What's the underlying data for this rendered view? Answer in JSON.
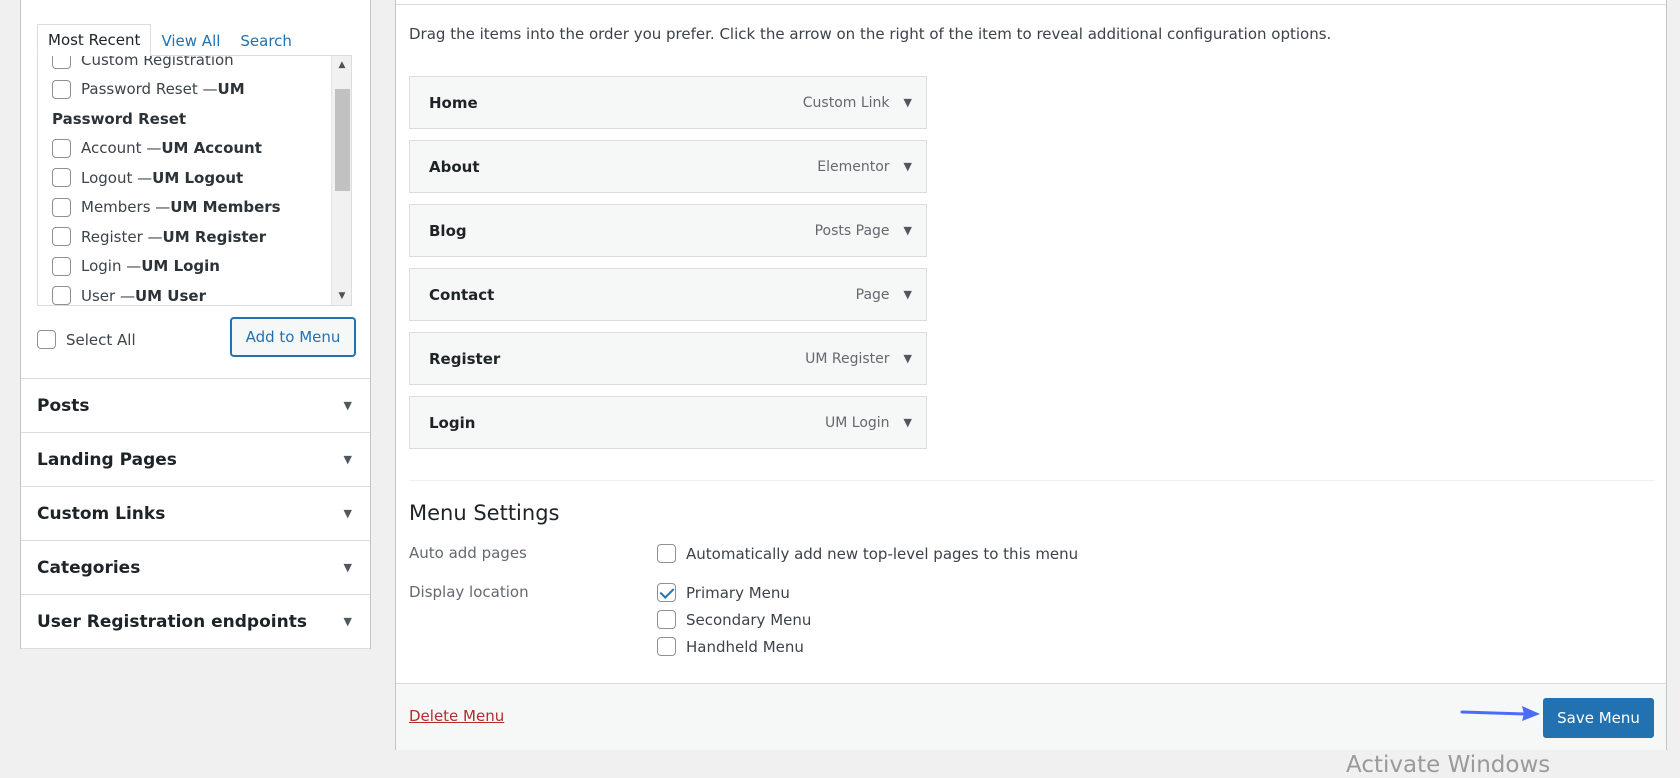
{
  "left_panel": {
    "tabs": [
      {
        "label": "Most Recent",
        "active": true
      },
      {
        "label": "View All",
        "active": false
      },
      {
        "label": "Search",
        "active": false
      }
    ],
    "items": [
      {
        "type": "checkbox",
        "label": "Custom Registration",
        "suffix": ""
      },
      {
        "type": "checkbox",
        "label": "Password Reset — ",
        "suffix": "UM"
      },
      {
        "type": "heading",
        "label": "Password Reset",
        "suffix": ""
      },
      {
        "type": "checkbox",
        "label": "Account — ",
        "suffix": "UM Account"
      },
      {
        "type": "checkbox",
        "label": "Logout — ",
        "suffix": "UM Logout"
      },
      {
        "type": "checkbox",
        "label": "Members — ",
        "suffix": "UM Members"
      },
      {
        "type": "checkbox",
        "label": "Register — ",
        "suffix": "UM Register"
      },
      {
        "type": "checkbox",
        "label": "Login — ",
        "suffix": "UM Login"
      },
      {
        "type": "checkbox",
        "label": "User — ",
        "suffix": "UM User"
      }
    ],
    "select_all_label": "Select All",
    "add_button_label": "Add to Menu",
    "accordion": [
      {
        "label": "Posts"
      },
      {
        "label": "Landing Pages"
      },
      {
        "label": "Custom Links"
      },
      {
        "label": "Categories"
      },
      {
        "label": "User Registration endpoints"
      }
    ]
  },
  "structure": {
    "instructions": "Drag the items into the order you prefer. Click the arrow on the right of the item to reveal additional configuration options.",
    "menu_items": [
      {
        "title": "Home",
        "type": "Custom Link"
      },
      {
        "title": "About",
        "type": "Elementor"
      },
      {
        "title": "Blog",
        "type": "Posts Page"
      },
      {
        "title": "Contact",
        "type": "Page"
      },
      {
        "title": "Register",
        "type": "UM Register"
      },
      {
        "title": "Login",
        "type": "UM Login"
      }
    ]
  },
  "settings": {
    "title": "Menu Settings",
    "auto_add_label": "Auto add pages",
    "auto_add_option": "Automatically add new top-level pages to this menu",
    "auto_add_checked": false,
    "display_location_label": "Display location",
    "locations": [
      {
        "label": "Primary Menu",
        "checked": true
      },
      {
        "label": "Secondary Menu",
        "checked": false
      },
      {
        "label": "Handheld Menu",
        "checked": false
      }
    ]
  },
  "footer": {
    "delete_label": "Delete Menu",
    "save_label": "Save Menu"
  },
  "watermark": "Activate Windows",
  "colors": {
    "accent": "#2271b1",
    "delete": "#b32d2e",
    "pointer_arrow": "#4a6cf7"
  }
}
